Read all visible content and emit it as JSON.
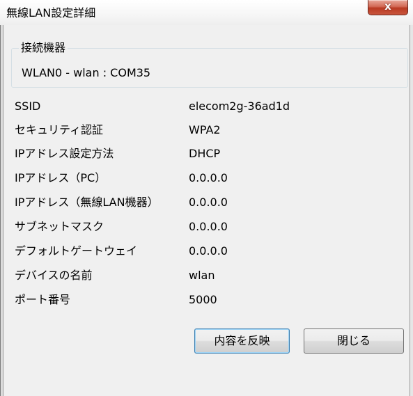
{
  "window": {
    "title": "無線LAN設定詳細",
    "close_glyph": "x"
  },
  "connected_device": {
    "label": "接続機器",
    "value": "WLAN0 - wlan : COM35"
  },
  "details": [
    {
      "label": "SSID",
      "value": "elecom2g-36ad1d"
    },
    {
      "label": "セキュリティ認証",
      "value": "WPA2"
    },
    {
      "label": "IPアドレス設定方法",
      "value": "DHCP"
    },
    {
      "label": "IPアドレス（PC）",
      "value": "0.0.0.0"
    },
    {
      "label": "IPアドレス（無線LAN機器）",
      "value": "0.0.0.0"
    },
    {
      "label": "サブネットマスク",
      "value": "0.0.0.0"
    },
    {
      "label": "デフォルトゲートウェイ",
      "value": "0.0.0.0"
    },
    {
      "label": "デバイスの名前",
      "value": "wlan"
    },
    {
      "label": "ポート番号",
      "value": "5000"
    }
  ],
  "buttons": {
    "apply_label": "内容を反映",
    "close_label": "閉じる"
  }
}
